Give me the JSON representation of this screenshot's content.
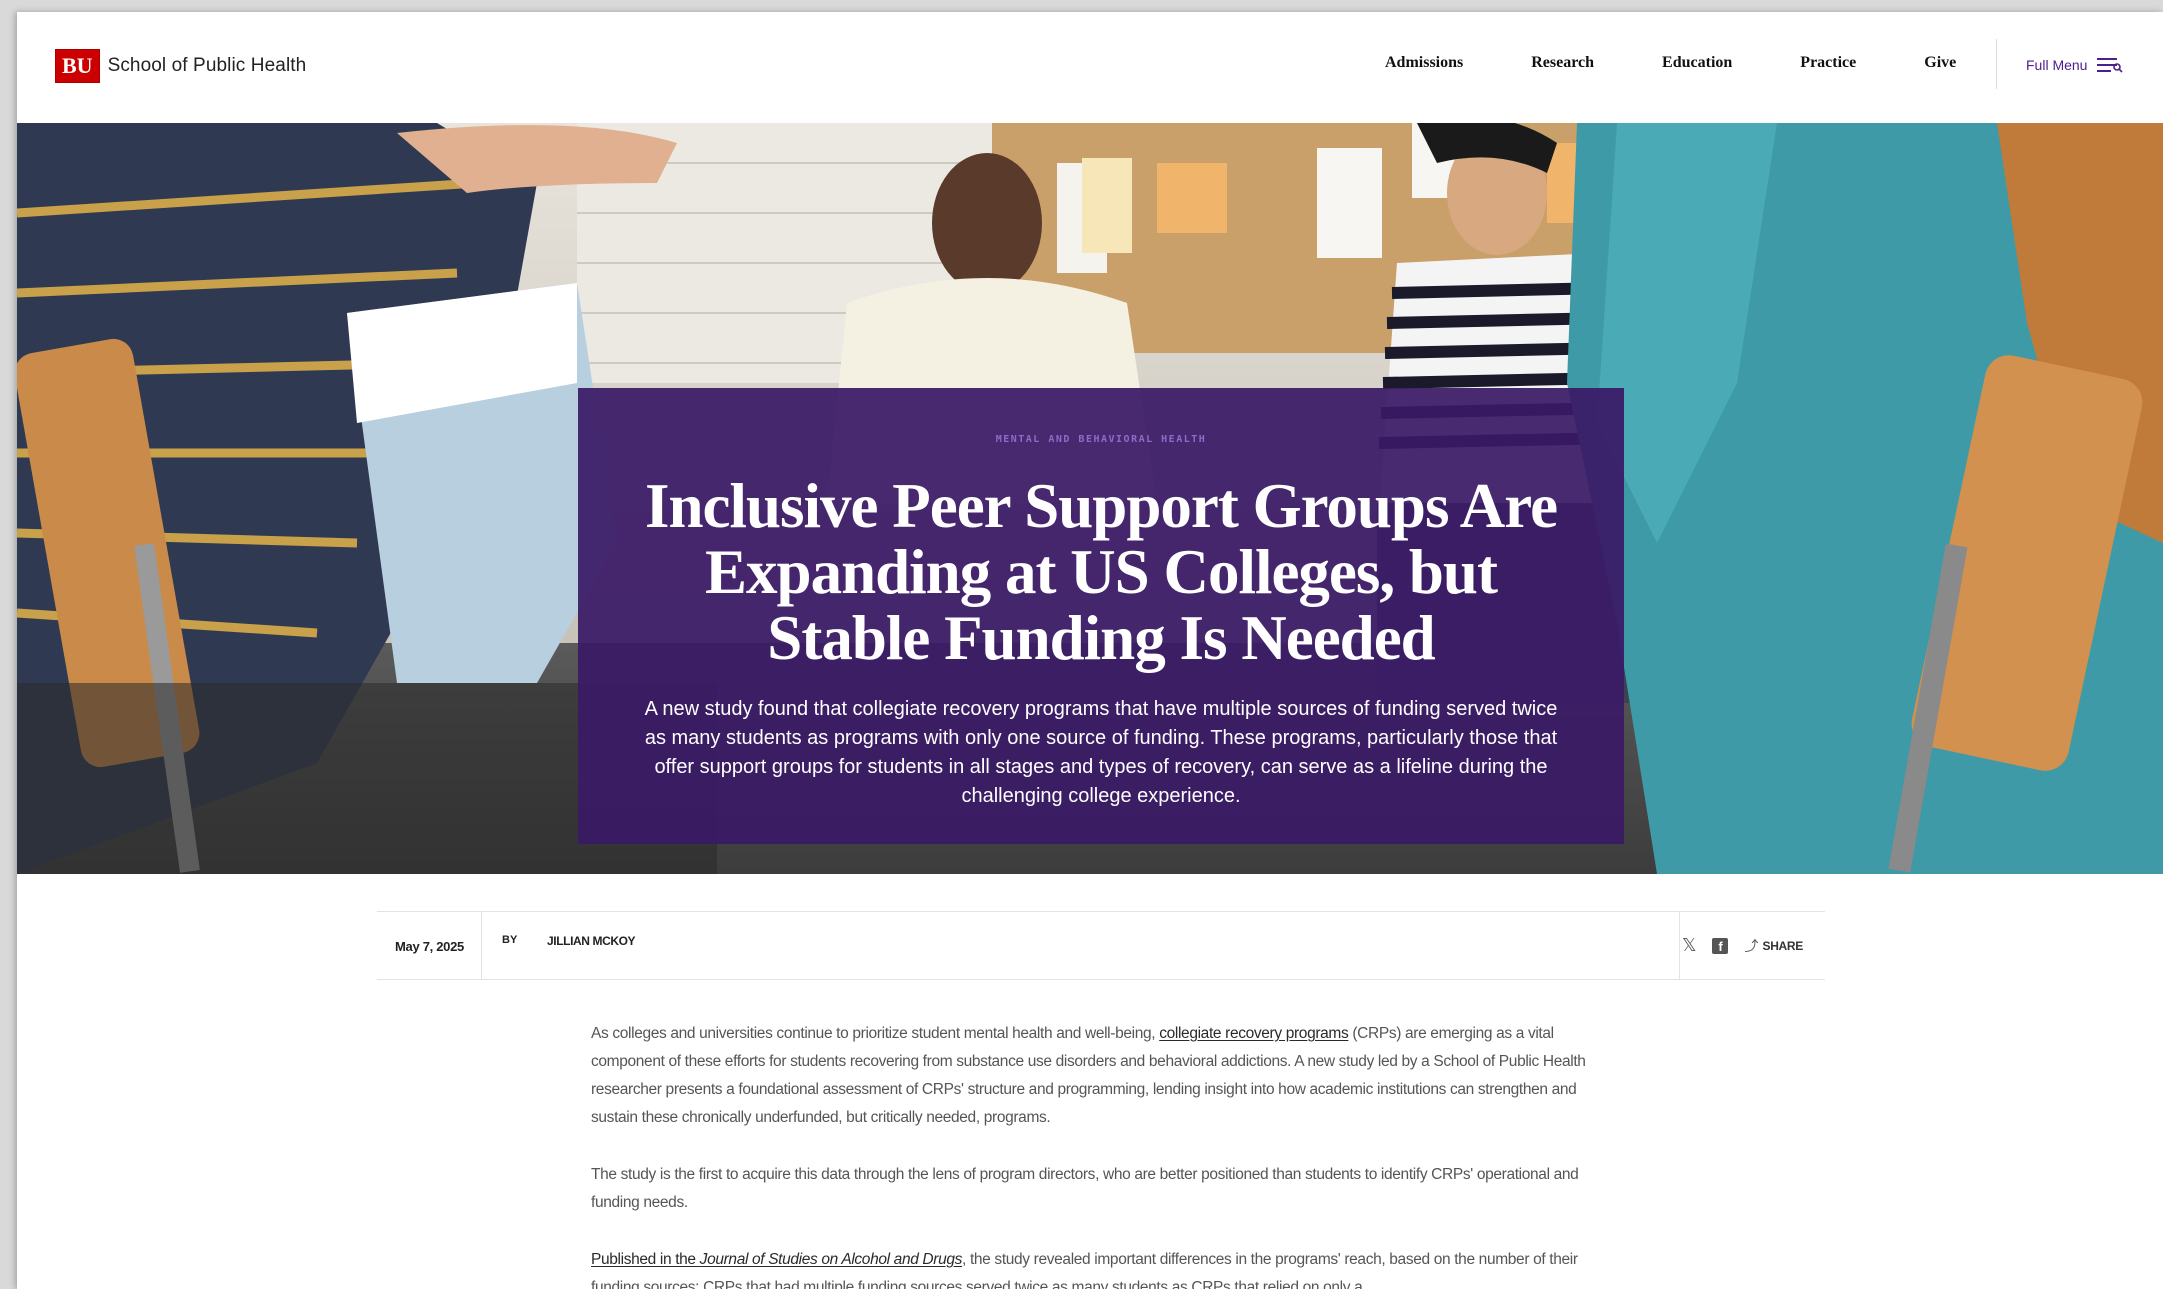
{
  "header": {
    "logo_mark": "BU",
    "logo_text": "School of Public Health",
    "nav": [
      "Admissions",
      "Research",
      "Education",
      "Practice",
      "Give"
    ],
    "full_menu_label": "Full Menu"
  },
  "hero": {
    "category": "MENTAL AND BEHAVIORAL HEALTH",
    "title": "Inclusive Peer Support Groups Are Expanding at US Colleges, but Stable Funding Is Needed",
    "deck": "A new study found that collegiate recovery programs that have multiple sources of funding served twice as many students as programs with only one source of funding. These programs, particularly those that offer support groups for students in all stages and types of recovery, can serve as a lifeline during the challenging college experience."
  },
  "meta": {
    "date": "May 7, 2025",
    "by": "BY",
    "author": "JILLIAN MCKOY",
    "share_label": "SHARE",
    "x_icon": "x-icon",
    "facebook_icon": "facebook-icon",
    "share_icon": "share-icon"
  },
  "article": {
    "p1_before": "As colleges and universities continue to prioritize student mental health and well-being, ",
    "p1_link": "collegiate recovery programs",
    "p1_after": " (CRPs) are emerging as a vital component of these efforts for students recovering from substance use disorders and behavioral addictions. A new study led by a School of Public Health researcher presents a foundational assessment of CRPs' structure and programming, lending insight into how academic institutions can strengthen and sustain these chronically underfunded, but critically needed, programs.",
    "p2": "The study is the first to acquire this data through the lens of program directors, who are better positioned than students to identify CRPs' operational and funding needs.",
    "p3_link_prefix": "Published in the ",
    "p3_link_journal": "Journal of Studies on Alcohol and Drugs",
    "p3_after": ", the study revealed important differences in the programs' reach, based on the number of their funding sources: CRPs that had multiple funding sources served twice as many students as CRPs that relied on only a"
  },
  "colors": {
    "bu_red": "#cc0000",
    "purple": "#3a1a66",
    "accent_purple": "#4b1f8c"
  }
}
